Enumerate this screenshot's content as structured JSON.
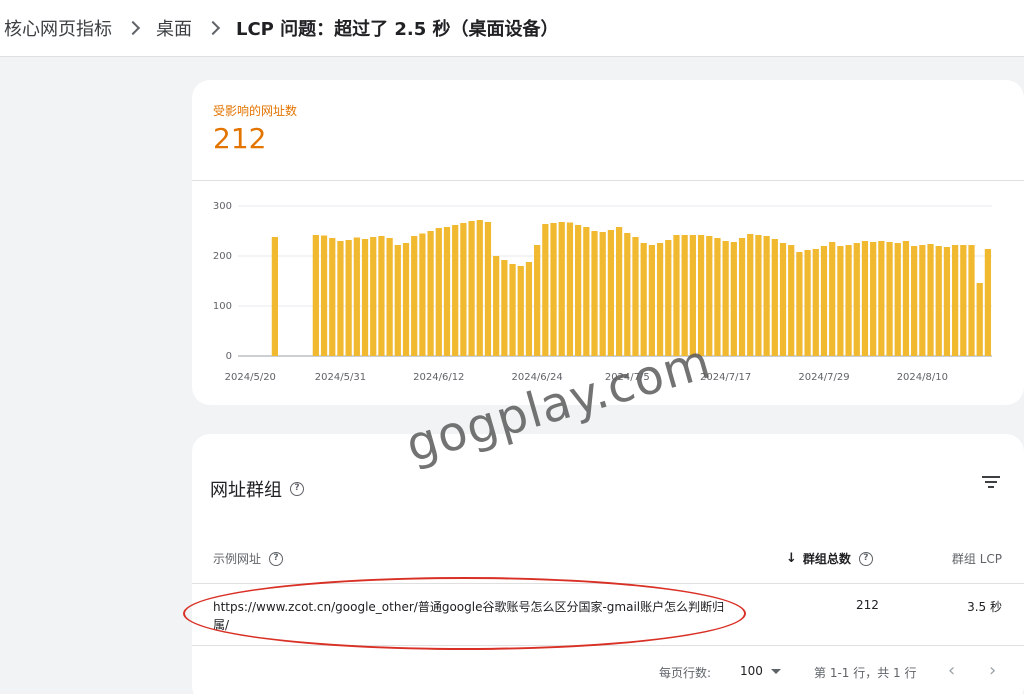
{
  "breadcrumb": {
    "items": [
      "核心网页指标",
      "桌面",
      "LCP 问题：超过了 2.5 秒（桌面设备）"
    ]
  },
  "metric": {
    "label": "受影响的网址数",
    "value": "212"
  },
  "chart_data": {
    "type": "bar",
    "ylim": [
      0,
      300
    ],
    "y_ticks": [
      "0",
      "100",
      "200",
      "300"
    ],
    "x_tick_labels": [
      "2024/5/20",
      "2024/5/31",
      "2024/6/12",
      "2024/6/24",
      "2024/7/5",
      "2024/7/17",
      "2024/7/29",
      "2024/8/10"
    ],
    "x_tick_indices": [
      1,
      12,
      24,
      36,
      47,
      59,
      71,
      83
    ],
    "values": [
      0,
      0,
      0,
      0,
      238,
      0,
      0,
      0,
      0,
      242,
      241,
      236,
      230,
      232,
      237,
      234,
      238,
      240,
      236,
      222,
      226,
      240,
      245,
      250,
      256,
      258,
      262,
      266,
      270,
      272,
      268,
      200,
      192,
      184,
      180,
      188,
      222,
      264,
      266,
      268,
      267,
      262,
      258,
      250,
      248,
      252,
      258,
      246,
      238,
      226,
      222,
      226,
      232,
      242,
      242,
      242,
      242,
      240,
      236,
      230,
      228,
      236,
      244,
      242,
      240,
      234,
      226,
      222,
      208,
      212,
      214,
      220,
      228,
      220,
      222,
      226,
      230,
      228,
      230,
      228,
      226,
      230,
      220,
      222,
      224,
      220,
      218,
      222,
      222,
      222,
      146,
      214
    ],
    "bar_color": "#f0b930"
  },
  "table": {
    "title": "网址群组",
    "columns": {
      "url": "示例网址",
      "total": "群组总数",
      "lcp": "群组 LCP"
    },
    "rows": [
      {
        "url": "https://www.zcot.cn/google_other/普通google谷歌账号怎么区分国家-gmail账户怎么判断归属/",
        "total": "212",
        "lcp": "3.5 秒"
      }
    ],
    "footer": {
      "rows_per_page_label": "每页行数:",
      "rows_per_page": "100",
      "range": "第 1-1 行，共 1 行"
    }
  },
  "watermark": "gogplay.com",
  "colors": {
    "accent": "#e37400",
    "bar": "#f0b930",
    "annotation": "#d93025"
  }
}
